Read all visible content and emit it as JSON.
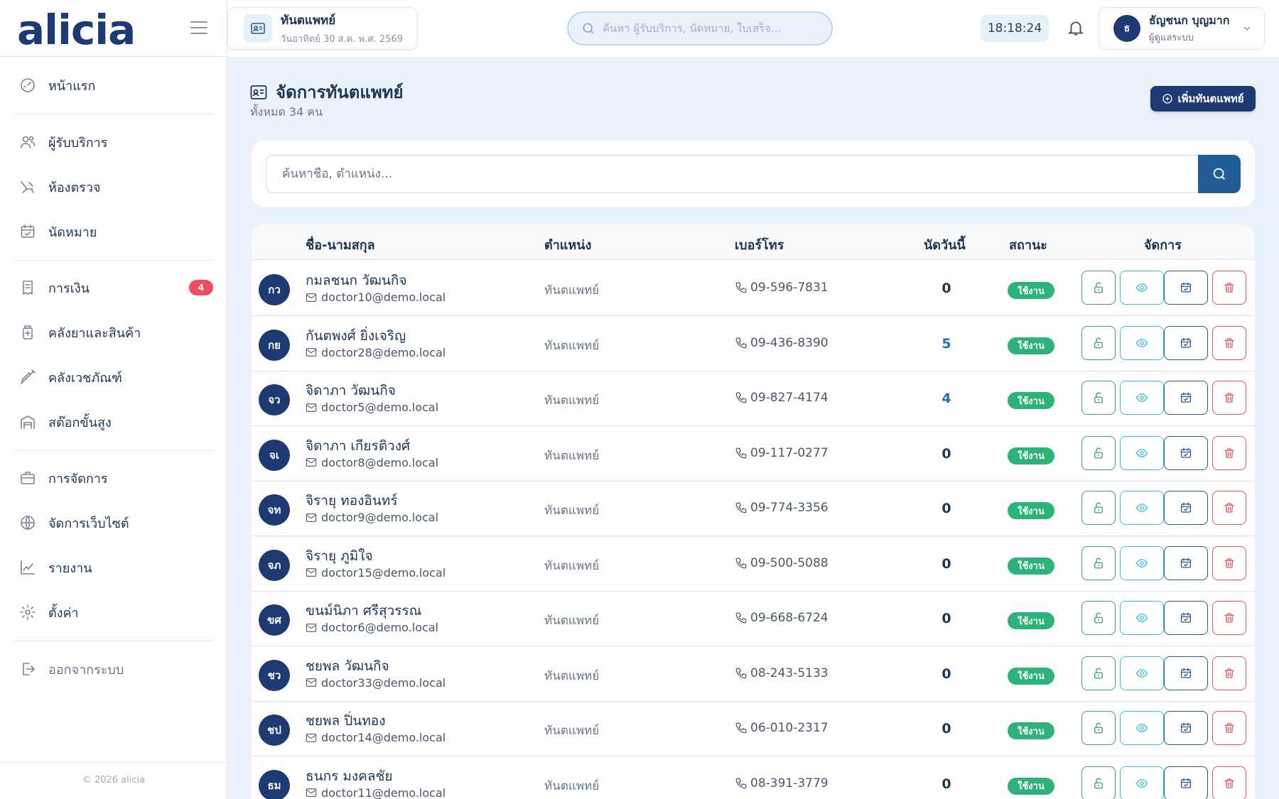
{
  "app": {
    "logo": "alicia"
  },
  "sidebar": {
    "items": [
      {
        "label": "หน้าแรก",
        "icon": "dashboard-icon"
      },
      {
        "label": "ผู้รับบริการ",
        "icon": "users-icon"
      },
      {
        "label": "ห้องตรวจ",
        "icon": "dental-chair-icon"
      },
      {
        "label": "นัดหมาย",
        "icon": "calendar-check-icon"
      },
      {
        "label": "การเงิน",
        "icon": "receipt-icon",
        "badge": "4"
      },
      {
        "label": "คลังยาและสินค้า",
        "icon": "medicine-icon"
      },
      {
        "label": "คลังเวชภัณฑ์",
        "icon": "syringe-icon"
      },
      {
        "label": "สต๊อกขั้นสูง",
        "icon": "warehouse-icon"
      },
      {
        "label": "การจัดการ",
        "icon": "briefcase-icon"
      },
      {
        "label": "จัดการเว็บไซต์",
        "icon": "globe-icon"
      },
      {
        "label": "รายงาน",
        "icon": "chart-line-icon"
      },
      {
        "label": "ตั้งค่า",
        "icon": "gear-icon"
      }
    ],
    "logout": "ออกจากระบบ",
    "copyright": "© 2026 alicia"
  },
  "topbar": {
    "page_chip": {
      "title": "ทันตแพทย์",
      "subtitle": "วันอาทิตย์ 30 ส.ค. พ.ศ. 2569"
    },
    "search_placeholder": "ค้นหา ผู้รับบริการ, นัดหมาย, ใบเสร็จ...",
    "clock": "18:18:24",
    "user": {
      "initial": "ธ",
      "name": "ธัญชนก บุญมาก",
      "role": "ผู้ดูแลระบบ"
    }
  },
  "main": {
    "title": "จัดการทันตแพทย์",
    "subtitle": "ทั้งหมด 34 คน",
    "add_button": "เพิ่มทันตแพทย์",
    "search_placeholder": "ค้นหาชื่อ, ตำแหน่ง..."
  },
  "table": {
    "headers": {
      "name": "ชื่อ-นามสกุล",
      "position": "ตำแหน่ง",
      "phone": "เบอร์โทร",
      "today": "นัดวันนี้",
      "status": "สถานะ",
      "actions": "จัดการ"
    },
    "rows": [
      {
        "initials": "กว",
        "name": "กมลชนก วัฒนกิจ",
        "email": "doctor10@demo.local",
        "position": "ทันตแพทย์",
        "phone": "09-596-7831",
        "today": "0",
        "status": "ใช้งาน"
      },
      {
        "initials": "กย",
        "name": "กันตพงศ์ ยิ่งเจริญ",
        "email": "doctor28@demo.local",
        "position": "ทันตแพทย์",
        "phone": "09-436-8390",
        "today": "5",
        "status": "ใช้งาน"
      },
      {
        "initials": "จว",
        "name": "จิดาภา วัฒนกิจ",
        "email": "doctor5@demo.local",
        "position": "ทันตแพทย์",
        "phone": "09-827-4174",
        "today": "4",
        "status": "ใช้งาน"
      },
      {
        "initials": "จเ",
        "name": "จิดาภา เกียรติวงศ์",
        "email": "doctor8@demo.local",
        "position": "ทันตแพทย์",
        "phone": "09-117-0277",
        "today": "0",
        "status": "ใช้งาน"
      },
      {
        "initials": "จท",
        "name": "จิรายุ ทองอินทร์",
        "email": "doctor9@demo.local",
        "position": "ทันตแพทย์",
        "phone": "09-774-3356",
        "today": "0",
        "status": "ใช้งาน"
      },
      {
        "initials": "จภ",
        "name": "จิรายุ ภูมิใจ",
        "email": "doctor15@demo.local",
        "position": "ทันตแพทย์",
        "phone": "09-500-5088",
        "today": "0",
        "status": "ใช้งาน"
      },
      {
        "initials": "ขศ",
        "name": "ขนม์นิภา ศรีสุวรรณ",
        "email": "doctor6@demo.local",
        "position": "ทันตแพทย์",
        "phone": "09-668-6724",
        "today": "0",
        "status": "ใช้งาน"
      },
      {
        "initials": "ชว",
        "name": "ชยพล วัฒนกิจ",
        "email": "doctor33@demo.local",
        "position": "ทันตแพทย์",
        "phone": "08-243-5133",
        "today": "0",
        "status": "ใช้งาน"
      },
      {
        "initials": "ชป",
        "name": "ชยพล ปิ่นทอง",
        "email": "doctor14@demo.local",
        "position": "ทันตแพทย์",
        "phone": "06-010-2317",
        "today": "0",
        "status": "ใช้งาน"
      },
      {
        "initials": "ธม",
        "name": "ธนกร มงคลชัย",
        "email": "doctor11@demo.local",
        "position": "ทันตแพทย์",
        "phone": "08-391-3779",
        "today": "0",
        "status": "ใช้งาน"
      }
    ]
  },
  "colors": {
    "brand": "#1e3a72",
    "accent": "#225d96",
    "status_active": "#2bb37a",
    "badge": "#ee4d5e"
  }
}
